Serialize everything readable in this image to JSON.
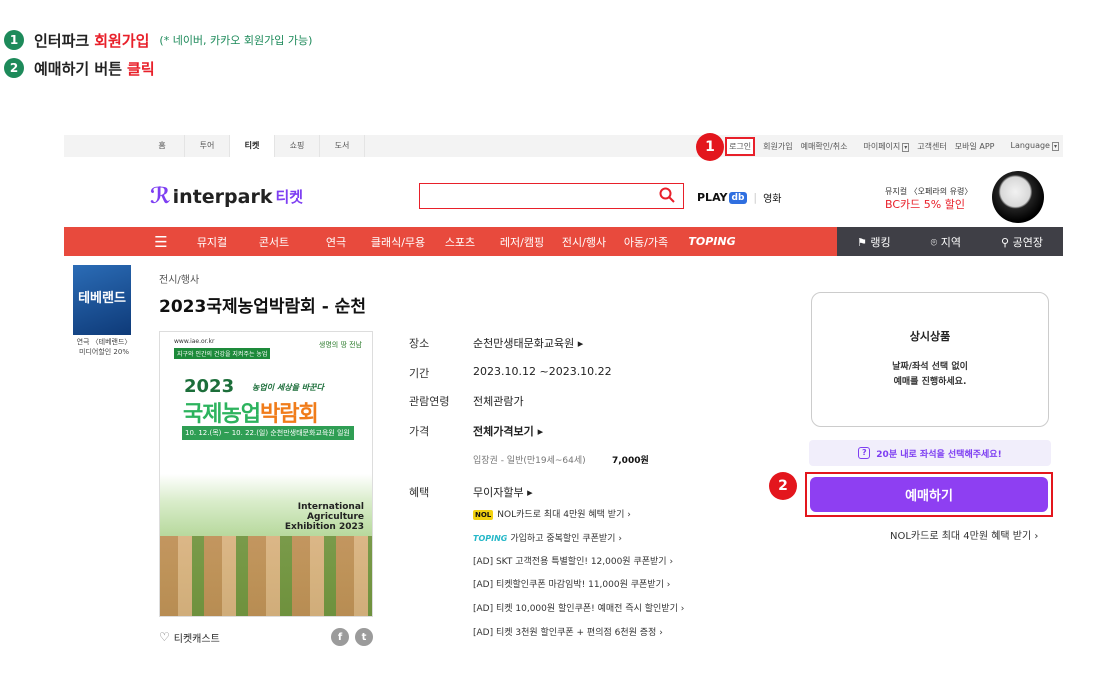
{
  "steps": [
    {
      "num": "1",
      "text": "인터파크",
      "highlight": "회원가입",
      "note": "(* 네이버, 카카오 회원가입 가능)"
    },
    {
      "num": "2",
      "text": "예매하기 버튼",
      "highlight": "클릭"
    }
  ],
  "markers": {
    "one": "1",
    "two": "2"
  },
  "topbar": {
    "tabs": [
      "홈",
      "투어",
      "티켓",
      "쇼핑",
      "도서"
    ],
    "links": {
      "login": "로그인",
      "signup": "회원가입",
      "booking": "예매확인/취소",
      "mypage": "마이페이지",
      "support": "고객센터",
      "mobile": "모바일 APP",
      "language": "Language"
    }
  },
  "header": {
    "logo_text": "interpark",
    "logo_ticket": "티켓",
    "search_placeholder": "",
    "play": "PLAY",
    "play_db": "db",
    "movie": "영화",
    "promo_line1": "뮤지컬 〈오페라의 유령〉",
    "promo_line2": "BC카드 5% 할인"
  },
  "nav": {
    "items": [
      "뮤지컬",
      "콘서트",
      "연극",
      "클래식/무용",
      "스포츠",
      "레저/캠핑",
      "전시/행사",
      "아동/가족"
    ],
    "toping": "TOPING",
    "right": [
      "랭킹",
      "지역",
      "공연장"
    ]
  },
  "side_ad": {
    "thumb_text": "테베랜드",
    "line1": "연극 〈테베랜드〉",
    "line2": "미디어할인 20%"
  },
  "product": {
    "category": "전시/행사",
    "title": "2023국제농업박람회 - 순천",
    "poster": {
      "url": "www.iae.or.kr",
      "tag": "지구와 인간의 건강을 지켜주는 농업",
      "org": "생명의 땅 전남",
      "year": "2023",
      "slogan": "농업이 세상을 바꾼다",
      "title_a": "국제농업",
      "title_b": "박람회",
      "dates": "10. 12.(목) ~ 10. 22.(일)   순천만생태문화교육원 일원",
      "en1": "International",
      "en2": "Agriculture",
      "en3": "Exhibition 2023"
    },
    "ticketcast": "티켓캐스트",
    "venue_label": "장소",
    "venue": "순천만생태문화교육원",
    "period_label": "기간",
    "period": "2023.10.12 ~2023.10.22",
    "age_label": "관람연령",
    "age": "전체관람가",
    "price_label": "가격",
    "price_view": "전체가격보기",
    "price_item": "입장권 - 일반(만19세~64세)",
    "price_value": "7,000원",
    "benefit_label": "혜택",
    "benefit": "무이자할부",
    "nol_badge": "NOL",
    "nol_text": "NOL카드로 최대 4만원 혜택 받기",
    "toping_badge": "TOPING",
    "toping_text": "가입하고 중복할인 쿠폰받기",
    "ads": [
      "[AD] SKT 고객전용 특별할인! 12,000원 쿠폰받기",
      "[AD] 티켓할인쿠폰 마감임박! 11,000원 쿠폰받기",
      "[AD] 티켓 10,000원 할인쿠폰! 예매전 즉시 할인받기",
      "[AD] 티켓 3천원 할인쿠폰 + 편의점 6천원 증정"
    ]
  },
  "booking": {
    "always": "상시상품",
    "notice1": "날짜/좌석 선택 없이",
    "notice2": "예매를 진행하세요.",
    "hint": "20분 내로 좌석을 선택해주세요!",
    "button": "예매하기",
    "nol_link": "NOL카드로 최대 4만원 혜택 받기"
  }
}
